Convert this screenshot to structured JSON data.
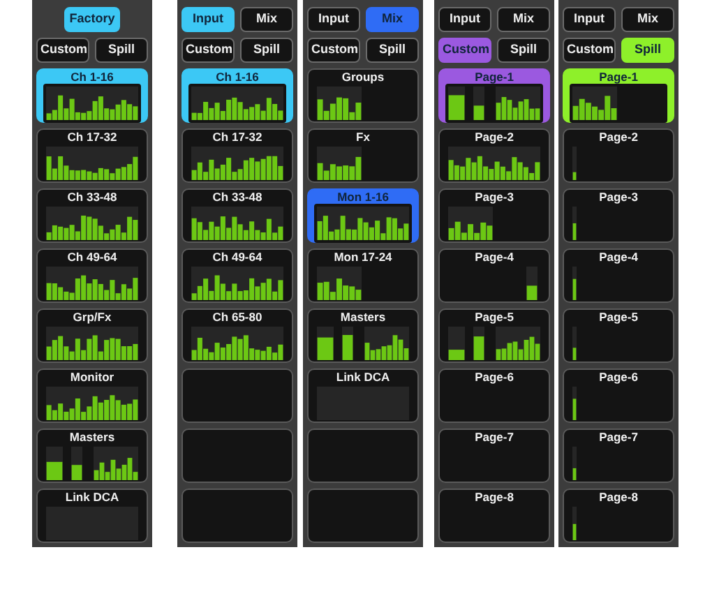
{
  "panels": [
    {
      "color": "#3cc8f5",
      "top_buttons": [
        {
          "label": "Factory",
          "selected": true
        }
      ],
      "mode_buttons": [
        {
          "label": "Custom",
          "selected": false
        },
        {
          "label": "Spill",
          "selected": false
        }
      ],
      "tiles": [
        {
          "label": "Ch 1-16",
          "selected": true,
          "kind": "bank"
        },
        {
          "label": "Ch 17-32",
          "selected": false,
          "kind": "bank"
        },
        {
          "label": "Ch 33-48",
          "selected": false,
          "kind": "bank"
        },
        {
          "label": "Ch 49-64",
          "selected": false,
          "kind": "bank"
        },
        {
          "label": "Grp/Fx",
          "selected": false,
          "kind": "bank"
        },
        {
          "label": "Monitor",
          "selected": false,
          "kind": "bank"
        },
        {
          "label": "Masters",
          "selected": false,
          "kind": "masters"
        },
        {
          "label": "Link DCA",
          "selected": false,
          "kind": "empty"
        }
      ]
    },
    {
      "color": "#3cc8f5",
      "top_buttons": [
        {
          "label": "Input",
          "selected": true
        },
        {
          "label": "Mix",
          "selected": false
        }
      ],
      "mode_buttons": [
        {
          "label": "Custom",
          "selected": false
        },
        {
          "label": "Spill",
          "selected": false
        }
      ],
      "tiles": [
        {
          "label": "Ch 1-16",
          "selected": true,
          "kind": "bank"
        },
        {
          "label": "Ch 17-32",
          "selected": false,
          "kind": "bank"
        },
        {
          "label": "Ch 33-48",
          "selected": false,
          "kind": "bank"
        },
        {
          "label": "Ch 49-64",
          "selected": false,
          "kind": "bank"
        },
        {
          "label": "Ch 65-80",
          "selected": false,
          "kind": "bank"
        },
        {
          "selected": false,
          "kind": "blank"
        },
        {
          "selected": false,
          "kind": "blank"
        },
        {
          "selected": false,
          "kind": "blank"
        }
      ]
    },
    {
      "color": "#2f6cf5",
      "top_buttons": [
        {
          "label": "Input",
          "selected": false
        },
        {
          "label": "Mix",
          "selected": true
        }
      ],
      "mode_buttons": [
        {
          "label": "Custom",
          "selected": false
        },
        {
          "label": "Spill",
          "selected": false
        }
      ],
      "tiles": [
        {
          "label": "Groups",
          "selected": false,
          "kind": "half"
        },
        {
          "label": "Fx",
          "selected": false,
          "kind": "half"
        },
        {
          "label": "Mon 1-16",
          "selected": true,
          "kind": "bank"
        },
        {
          "label": "Mon 17-24",
          "selected": false,
          "kind": "half"
        },
        {
          "label": "Masters",
          "selected": false,
          "kind": "masters"
        },
        {
          "label": "Link DCA",
          "selected": false,
          "kind": "empty"
        },
        {
          "selected": false,
          "kind": "blank"
        },
        {
          "selected": false,
          "kind": "blank"
        }
      ]
    },
    {
      "color": "#9b59e0",
      "top_buttons": [
        {
          "label": "Input",
          "selected": false
        },
        {
          "label": "Mix",
          "selected": false
        }
      ],
      "mode_buttons": [
        {
          "label": "Custom",
          "selected": true
        },
        {
          "label": "Spill",
          "selected": false
        }
      ],
      "tiles": [
        {
          "label": "Page-1",
          "selected": true,
          "kind": "masters"
        },
        {
          "label": "Page-2",
          "selected": false,
          "kind": "bank"
        },
        {
          "label": "Page-3",
          "selected": false,
          "kind": "half"
        },
        {
          "label": "Page-4",
          "selected": false,
          "kind": "right"
        },
        {
          "label": "Page-5",
          "selected": false,
          "kind": "masters"
        },
        {
          "label": "Page-6",
          "selected": false,
          "kind": "blank"
        },
        {
          "label": "Page-7",
          "selected": false,
          "kind": "blank"
        },
        {
          "label": "Page-8",
          "selected": false,
          "kind": "blank"
        }
      ]
    },
    {
      "color": "#8ef02a",
      "top_buttons": [
        {
          "label": "Input",
          "selected": false
        },
        {
          "label": "Mix",
          "selected": false
        }
      ],
      "mode_buttons": [
        {
          "label": "Custom",
          "selected": false
        },
        {
          "label": "Spill",
          "selected": true
        }
      ],
      "tiles": [
        {
          "label": "Page-1",
          "selected": true,
          "kind": "half"
        },
        {
          "label": "Page-2",
          "selected": false,
          "kind": "single"
        },
        {
          "label": "Page-3",
          "selected": false,
          "kind": "single"
        },
        {
          "label": "Page-4",
          "selected": false,
          "kind": "single"
        },
        {
          "label": "Page-5",
          "selected": false,
          "kind": "single"
        },
        {
          "label": "Page-6",
          "selected": false,
          "kind": "single"
        },
        {
          "label": "Page-7",
          "selected": false,
          "kind": "single"
        },
        {
          "label": "Page-8",
          "selected": false,
          "kind": "single"
        }
      ]
    }
  ]
}
